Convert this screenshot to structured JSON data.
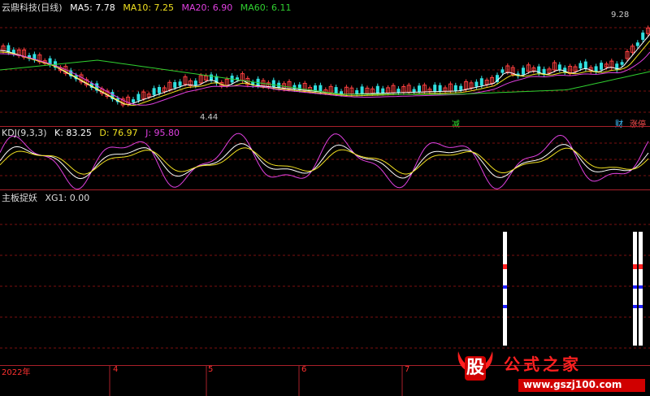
{
  "main_panel": {
    "title": "云鼎科技(日线)",
    "ma": [
      {
        "label": "MA5: 7.78",
        "color": "#ffffff"
      },
      {
        "label": "MA10: 7.25",
        "color": "#f0e020"
      },
      {
        "label": "MA20: 6.90",
        "color": "#e040e0"
      },
      {
        "label": "MA60: 6.11",
        "color": "#30d030"
      }
    ],
    "high_label": "9.28",
    "low_label": "4.44",
    "markers": {
      "reduce": "减",
      "finance": "财",
      "limit_up": "涨停"
    }
  },
  "kdj_panel": {
    "title": "KDJ(9,3,3)",
    "k": "K: 83.25",
    "d": "D: 76.97",
    "j": "J: 95.80",
    "colors": {
      "k": "#ffffff",
      "d": "#f0e020",
      "j": "#e040e0"
    }
  },
  "signal_panel": {
    "title": "主板捉妖",
    "xg": "XG1: 0.00"
  },
  "time_axis": [
    "2022年",
    "4",
    "5",
    "6",
    "7"
  ],
  "watermark": {
    "icon_text": "股",
    "site_name": "公式之家",
    "url": "www.gszj100.com"
  },
  "colors": {
    "grid": "#7a1010",
    "separator": "#a8202a",
    "up": "#ff4040",
    "down": "#30e0e0"
  }
}
